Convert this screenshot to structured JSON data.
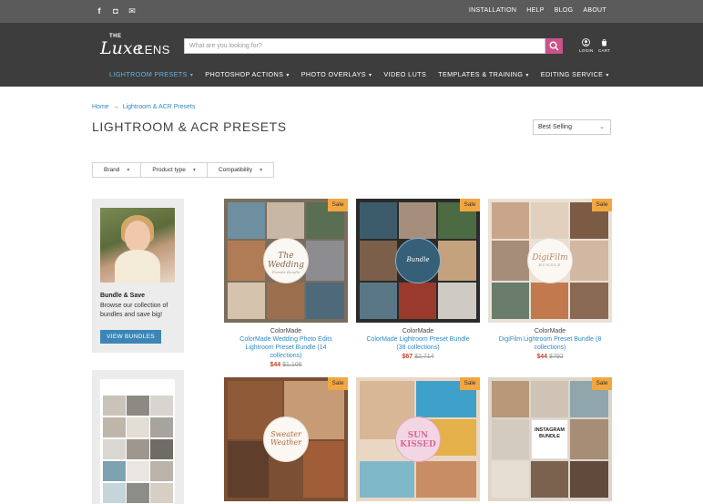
{
  "topbar": {
    "social": [
      {
        "icon": "facebook-icon",
        "glyph": "f"
      },
      {
        "icon": "instagram-icon",
        "glyph": "◘"
      },
      {
        "icon": "email-icon",
        "glyph": "✉"
      }
    ],
    "links": [
      "INSTALLATION",
      "HELP",
      "BLOG",
      "ABOUT"
    ]
  },
  "header": {
    "logo": {
      "the": "THE",
      "luxe": "Luxe",
      "lens": "LENS"
    },
    "search_placeholder": "What are you looking for?",
    "login_label": "LOGIN",
    "cart_label": "CART"
  },
  "nav": [
    {
      "label": "LIGHTROOM PRESETS",
      "active": true
    },
    {
      "label": "PHOTOSHOP ACTIONS",
      "active": false
    },
    {
      "label": "PHOTO OVERLAYS",
      "active": false
    },
    {
      "label": "VIDEO LUTS",
      "active": false
    },
    {
      "label": "TEMPLATES & TRAINING",
      "active": false
    },
    {
      "label": "EDITING SERVICE",
      "active": false
    }
  ],
  "breadcrumb": {
    "home": "Home",
    "sep": "→",
    "current": "Lightroom & ACR Presets"
  },
  "page_title": "LIGHTROOM & ACR PRESETS",
  "sort": {
    "selected": "Best Selling"
  },
  "filters": [
    "Brand",
    "Product type",
    "Compatibility"
  ],
  "promo": {
    "heading": "Bundle & Save",
    "text": "Browse our collection of bundles and save big!",
    "button": "VIEW BUNDLES"
  },
  "products": [
    {
      "vendor": "ColorMade",
      "name": "ColorMade Wedding Photo Edits Lightroom Preset Bundle (14 collections)",
      "price": "$44",
      "compare": "$1,106",
      "sale": "Sale",
      "badge": "The Wedding",
      "badge_sub": "Presets Bundle"
    },
    {
      "vendor": "ColorMade",
      "name": "ColorMade Lightroom Preset Bundle (38 collections)",
      "price": "$67",
      "compare": "$2,714",
      "sale": "Sale",
      "badge": "Bundle",
      "badge_sub": ""
    },
    {
      "vendor": "ColorMade",
      "name": "DigiFilm Lightroom Preset Bundle (8 collections)",
      "price": "$44",
      "compare": "$792",
      "sale": "Sale",
      "badge": "DigiFilm",
      "badge_sub": "BUNDLE"
    },
    {
      "vendor": "",
      "name": "",
      "price": "",
      "compare": "",
      "sale": "Sale",
      "badge": "Sweater Weather",
      "badge_sub": ""
    },
    {
      "vendor": "",
      "name": "",
      "price": "",
      "compare": "",
      "sale": "Sale",
      "badge": "SUN KISSED",
      "badge_sub": ""
    },
    {
      "vendor": "",
      "name": "",
      "price": "",
      "compare": "",
      "sale": "Sale",
      "badge": "INSTAGRAM BUNDLE",
      "badge_sub": ""
    }
  ],
  "colors": {
    "accent_blue": "#2d8ac7",
    "active_nav": "#62b7e5",
    "sale": "#f2a640",
    "price": "#c6432a",
    "search_button": "#c9548a"
  }
}
